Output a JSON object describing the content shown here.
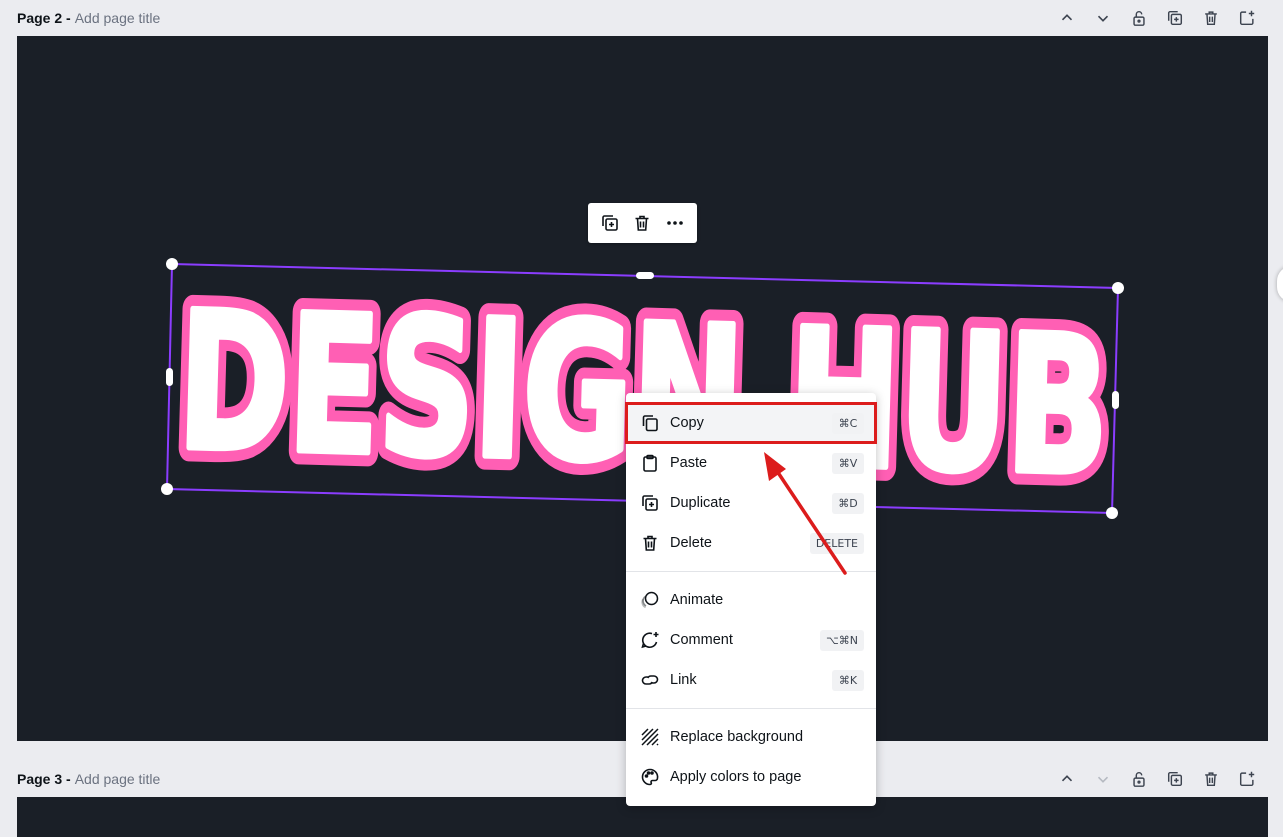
{
  "page2": {
    "label": "Page 2 -",
    "title_placeholder": "Add page title",
    "actions": [
      "move-up",
      "move-down",
      "lock",
      "duplicate",
      "delete",
      "add"
    ]
  },
  "page3": {
    "label": "Page 3 -",
    "title_placeholder": "Add page title"
  },
  "canvas": {
    "background": "#1a1f27",
    "text_graphic": "DESIGN HUB",
    "text_fill": "#ffffff",
    "text_outline": "#ff5fb4",
    "selection_color": "#8b3dff"
  },
  "floating_toolbar": {
    "icons": [
      "duplicate-icon",
      "trash-icon",
      "more-icon"
    ]
  },
  "context_menu": {
    "items": [
      {
        "label": "Copy",
        "shortcut": "⌘C",
        "icon": "copy-icon",
        "highlighted": true
      },
      {
        "label": "Paste",
        "shortcut": "⌘V",
        "icon": "paste-icon"
      },
      {
        "label": "Duplicate",
        "shortcut": "⌘D",
        "icon": "duplicate-icon"
      },
      {
        "label": "Delete",
        "shortcut": "DELETE",
        "icon": "trash-icon"
      },
      {
        "label": "Animate",
        "shortcut": "",
        "icon": "animate-icon"
      },
      {
        "label": "Comment",
        "shortcut": "⌥⌘N",
        "icon": "comment-icon"
      },
      {
        "label": "Link",
        "shortcut": "⌘K",
        "icon": "link-icon"
      },
      {
        "label": "Replace background",
        "shortcut": "",
        "icon": "pattern-icon"
      },
      {
        "label": "Apply colors to page",
        "shortcut": "",
        "icon": "palette-icon"
      }
    ]
  },
  "annotation": {
    "highlight_color": "#dc1c1c",
    "arrow_color": "#dc1c1c"
  }
}
